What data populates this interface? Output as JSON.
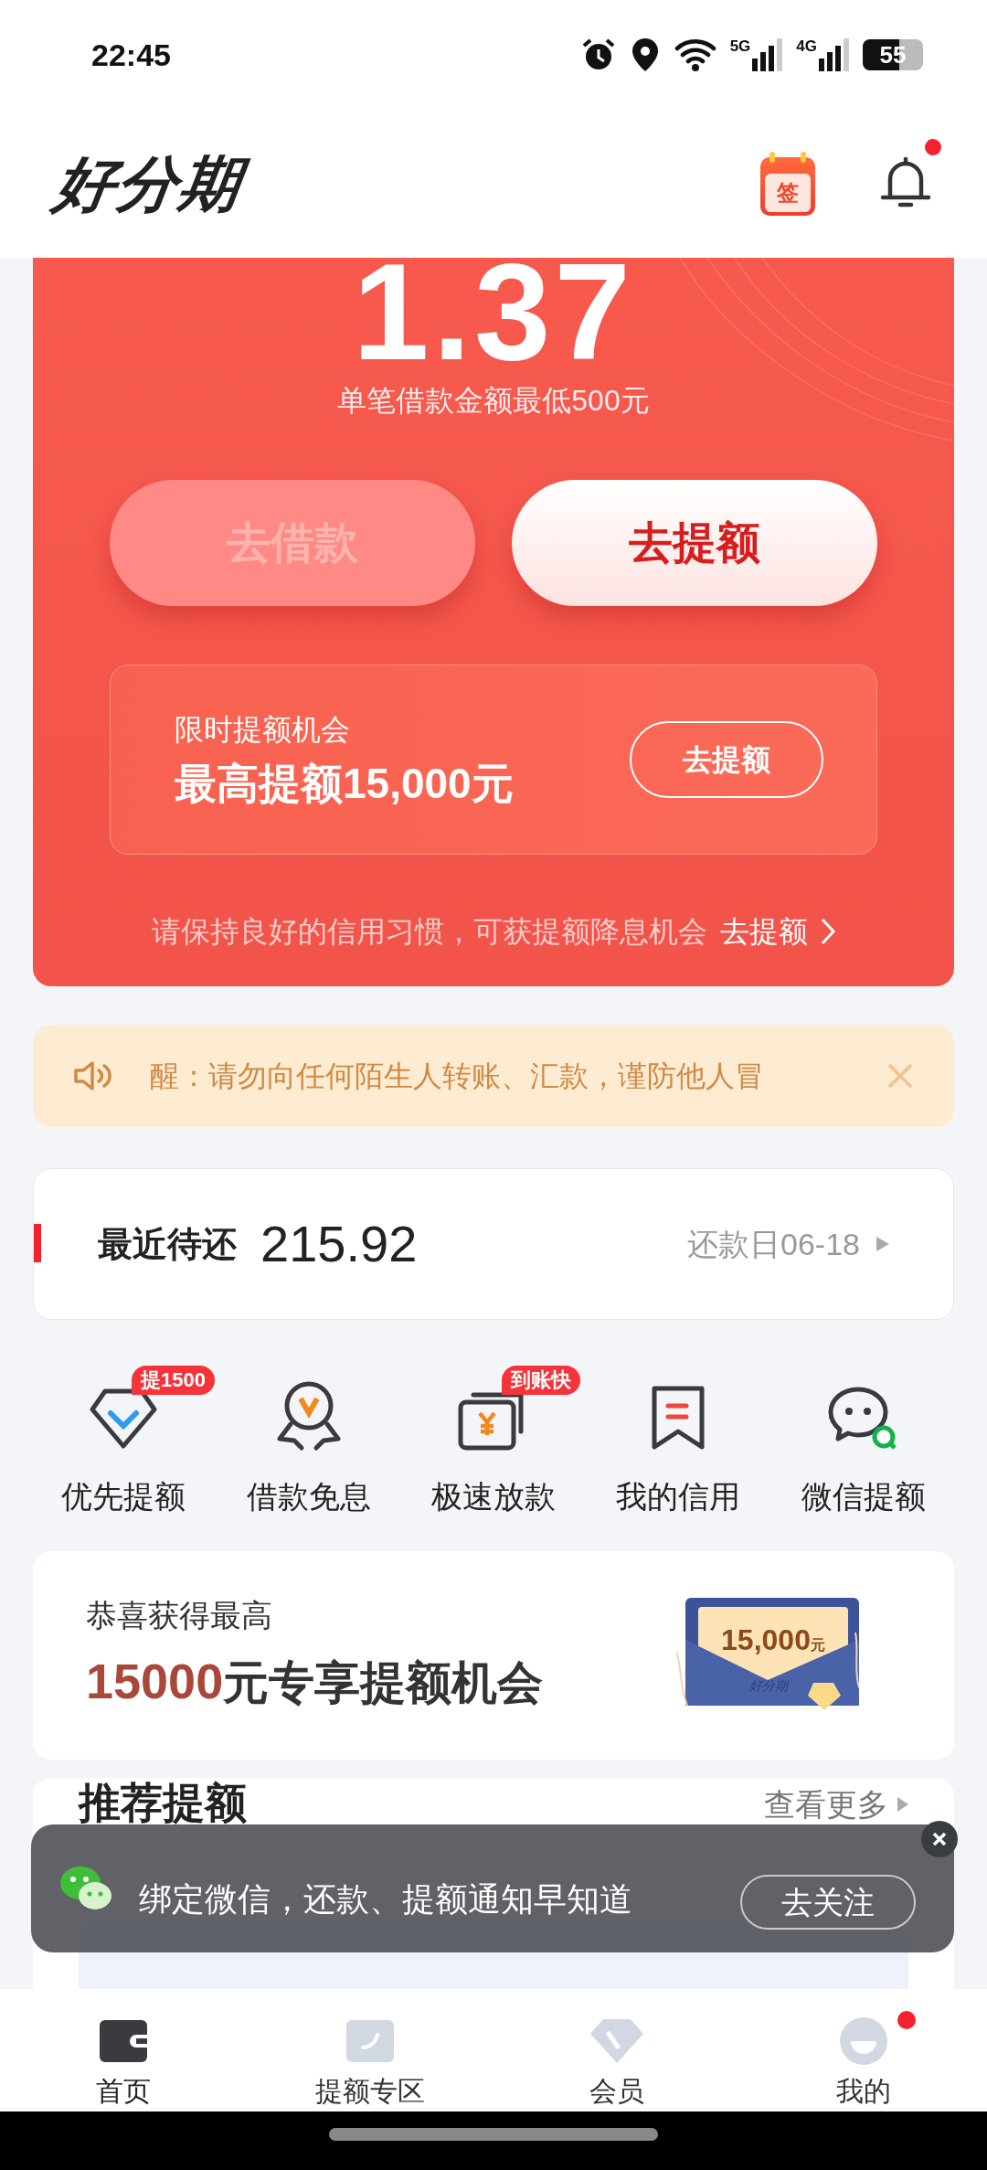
{
  "status_bar": {
    "time": "22:45",
    "network_1": "5G",
    "network_2": "4G",
    "battery": "55"
  },
  "header": {
    "logo": "好分期",
    "sign_in_label": "签",
    "bell_has_dot": true
  },
  "credit_card": {
    "amount": "1.37",
    "note": "单笔借款金额最低500元",
    "buttons": [
      {
        "label": "去借款",
        "disabled": true
      },
      {
        "label": "去提额",
        "disabled": false
      }
    ],
    "offer": {
      "title": "限时提额机会",
      "headline": "最高提额15,000元",
      "button": "去提额"
    },
    "footer": {
      "text": "请保持良好的信用习惯，可获提额降息机会",
      "link": "去提额"
    }
  },
  "notice": {
    "text": "醒：请勿向任何陌生人转账、汇款，谨防他人冒"
  },
  "repayment": {
    "label": "最近待还",
    "amount": "215.92",
    "due": "还款日06-18"
  },
  "shortcuts": [
    {
      "label": "优先提额",
      "badge": "提1500",
      "kind": "diamond"
    },
    {
      "label": "借款免息",
      "kind": "medal"
    },
    {
      "label": "极速放款",
      "badge": "到账快",
      "kind": "wallet"
    },
    {
      "label": "我的信用",
      "kind": "bookmark"
    },
    {
      "label": "微信提额",
      "kind": "chat"
    }
  ],
  "promo_card": {
    "line1": "恭喜获得最高",
    "amount": "15000",
    "rest": "元专享提额机会",
    "envelope_amount": "15,000",
    "envelope_unit": "元",
    "envelope_logo": "好分期"
  },
  "recommend": {
    "title": "推荐提额",
    "more": "查看更多"
  },
  "toast": {
    "text": "绑定微信，还款、提额通知早知道",
    "button": "去关注"
  },
  "bottom_nav": [
    {
      "label": "首页",
      "selected": true,
      "kind": "wallet",
      "has_dot": false
    },
    {
      "label": "提额专区",
      "selected": false,
      "kind": "card",
      "has_dot": false
    },
    {
      "label": "会员",
      "selected": false,
      "kind": "diamond",
      "has_dot": false
    },
    {
      "label": "我的",
      "selected": false,
      "kind": "face",
      "has_dot": true
    }
  ]
}
